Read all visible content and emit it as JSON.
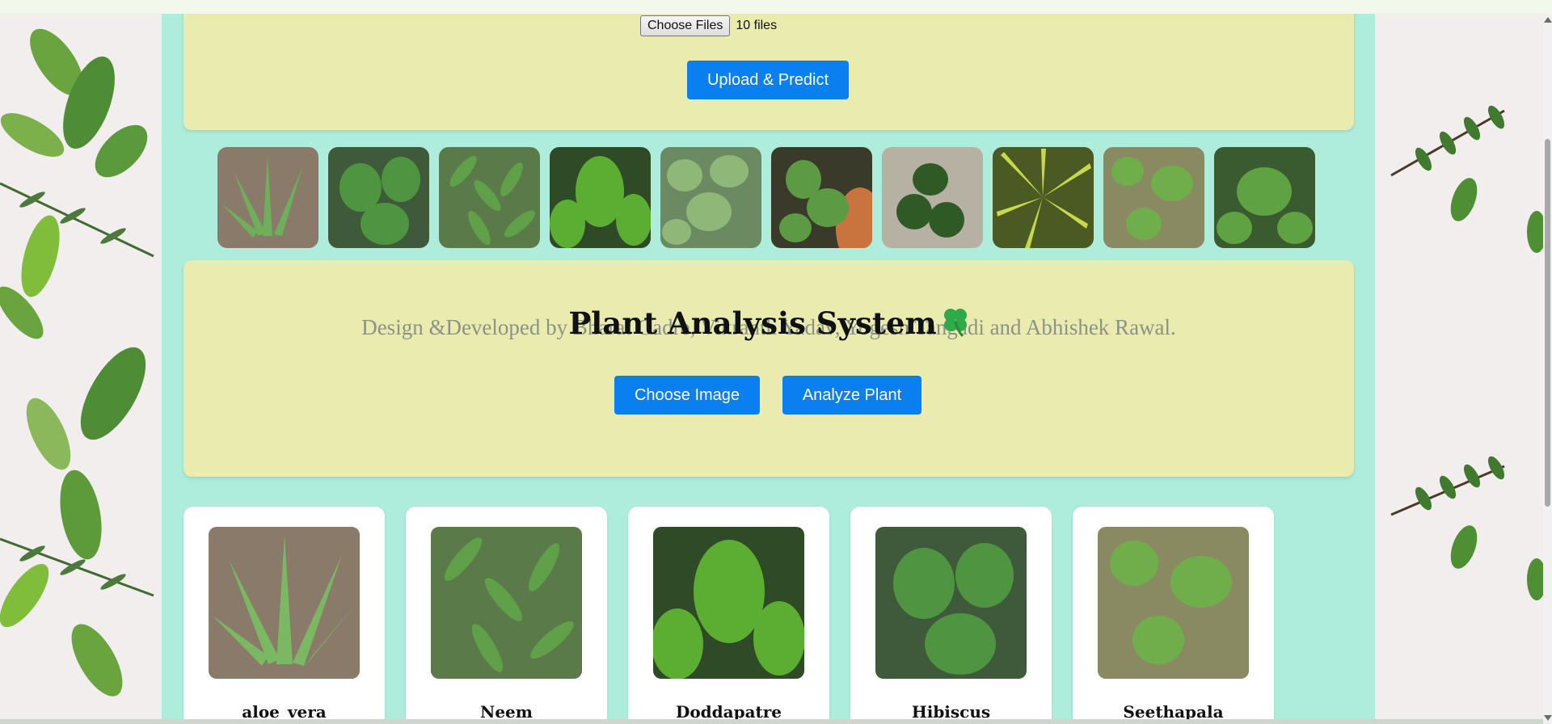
{
  "upload": {
    "choose_files_label": "Choose Files",
    "file_count": "10 files",
    "upload_button": "Upload & Predict"
  },
  "gallery": {
    "thumbnails": [
      "plant-photo-1",
      "plant-photo-2",
      "plant-photo-3",
      "plant-photo-4",
      "plant-photo-5",
      "plant-photo-6",
      "plant-photo-7",
      "plant-photo-8",
      "plant-photo-9",
      "plant-photo-10"
    ]
  },
  "analysis": {
    "credit_text": "Design &Developed by Bharat Gadre, Vikranth Yadav, Yogesh Tangadi and Abhishek Rawal.",
    "title": "Plant Analysis System",
    "title_icon": "four-leaf-clover-icon",
    "choose_image_button": "Choose Image",
    "analyze_button": "Analyze Plant"
  },
  "plants": [
    {
      "name": "aloe_vera"
    },
    {
      "name": "Neem"
    },
    {
      "name": "Doddapatre"
    },
    {
      "name": "Hibiscus"
    },
    {
      "name": "Seethapala"
    }
  ],
  "colors": {
    "accent_blue": "#0a7ff0",
    "panel_yellow": "#e9ecae",
    "page_mint": "#aeeddc"
  }
}
